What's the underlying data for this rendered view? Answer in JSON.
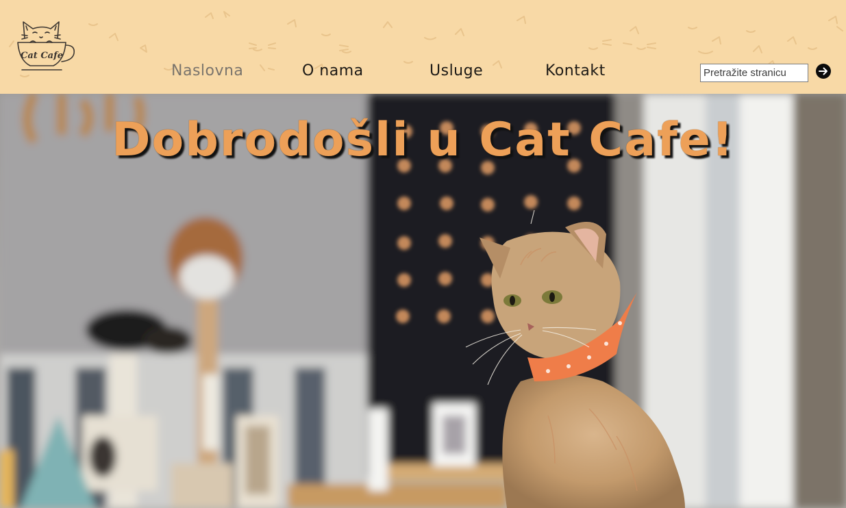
{
  "brand": {
    "logo_text": "Cat Cafe"
  },
  "nav": {
    "items": [
      {
        "label": "Naslovna",
        "active": true
      },
      {
        "label": "O nama",
        "active": false
      },
      {
        "label": "Usluge",
        "active": false
      },
      {
        "label": "Kontakt",
        "active": false
      }
    ]
  },
  "search": {
    "placeholder": "Pretražite stranicu",
    "value": "",
    "button_icon": "arrow-right-circle-icon"
  },
  "hero": {
    "title": "Dobrodošli u Cat Cafe!"
  },
  "colors": {
    "header_background": "#f8d9a6",
    "title_orange": "#eda058",
    "nav_text": "#1d1a16",
    "nav_active_text": "#7a746c"
  }
}
